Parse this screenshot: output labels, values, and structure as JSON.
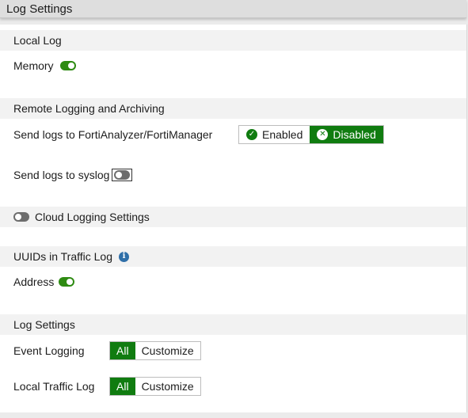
{
  "panel": {
    "title": "Log Settings"
  },
  "local_log": {
    "heading": "Local Log",
    "memory_label": "Memory",
    "memory_enabled": true
  },
  "remote": {
    "heading": "Remote Logging and Archiving",
    "faz_label": "Send logs to FortiAnalyzer/FortiManager",
    "faz_options": [
      "Enabled",
      "Disabled"
    ],
    "faz_selected": "Disabled",
    "syslog_label": "Send logs to syslog",
    "syslog_enabled": false
  },
  "cloud": {
    "label": "Cloud Logging Settings",
    "enabled": false
  },
  "uuids": {
    "heading": "UUIDs in Traffic Log",
    "address_label": "Address",
    "address_enabled": true
  },
  "log_settings": {
    "heading": "Log Settings",
    "event_label": "Event Logging",
    "event_options": [
      "All",
      "Customize"
    ],
    "event_selected": "All",
    "traffic_label": "Local Traffic Log",
    "traffic_options": [
      "All",
      "Customize"
    ],
    "traffic_selected": "All"
  },
  "colors": {
    "accent_green": "#107c10",
    "toggle_on": "#2e8b12",
    "toggle_off": "#6d6d6d",
    "info_blue": "#2f6fa8"
  },
  "icons": {
    "enabled_option": "check-circle-icon",
    "disabled_option": "x-circle-icon",
    "uuid_info": "info-icon"
  }
}
